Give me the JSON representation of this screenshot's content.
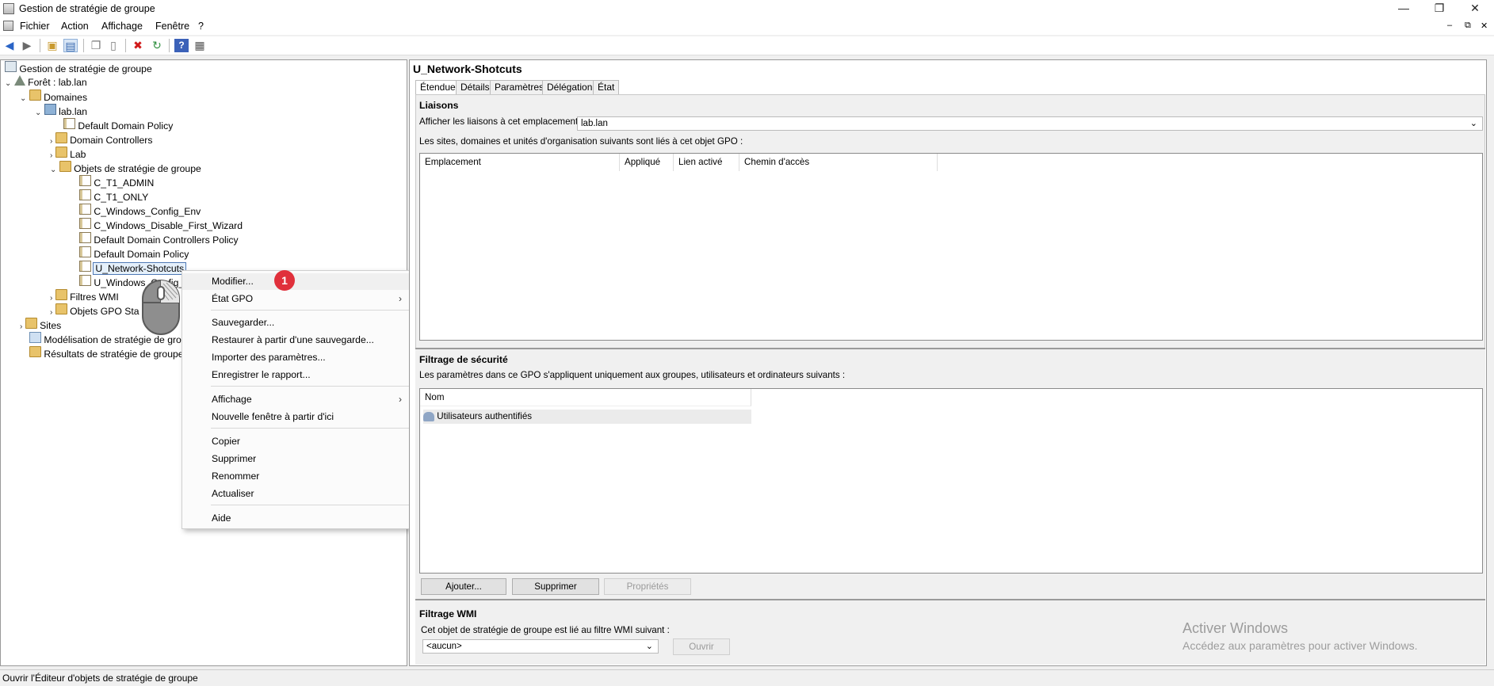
{
  "window": {
    "title": "Gestion de stratégie de groupe",
    "controls": [
      "—",
      "❐",
      "✕"
    ],
    "inner_controls": [
      "–",
      "⧉",
      "✕"
    ]
  },
  "menubar": {
    "items": [
      "Fichier",
      "Action",
      "Affichage",
      "Fenêtre",
      "?"
    ]
  },
  "tree": {
    "root": "Gestion de stratégie de groupe",
    "forest": "Forêt : lab.lan",
    "domains": "Domaines",
    "domain": "lab.lan",
    "default_domain_policy": "Default Domain Policy",
    "domain_controllers": "Domain Controllers",
    "lab": "Lab",
    "gpo_container": "Objets de stratégie de groupe",
    "gpos": [
      "C_T1_ADMIN",
      "C_T1_ONLY",
      "C_Windows_Config_Env",
      "C_Windows_Disable_First_Wizard",
      "Default Domain Controllers Policy",
      "Default Domain Policy",
      "U_Network-Shotcuts",
      "U_Windows_Config_"
    ],
    "wmi_filters": "Filtres WMI",
    "starter_gpos": "Objets GPO Sta",
    "sites": "Sites",
    "modeling": "Modélisation de stratégie de gro",
    "results": "Résultats de stratégie de groupe"
  },
  "context_menu": {
    "badge": "1",
    "items": {
      "modifier": "Modifier...",
      "etat_gpo": "État GPO",
      "sauvegarder": "Sauvegarder...",
      "restaurer": "Restaurer à partir d'une sauvegarde...",
      "importer": "Importer des paramètres...",
      "enregistrer": "Enregistrer le rapport...",
      "affichage": "Affichage",
      "nouvelle_fenetre": "Nouvelle fenêtre à partir d'ici",
      "copier": "Copier",
      "supprimer": "Supprimer",
      "renommer": "Renommer",
      "actualiser": "Actualiser",
      "aide": "Aide"
    }
  },
  "right": {
    "title": "U_Network-Shotcuts",
    "tabs": [
      "Étendue",
      "Détails",
      "Paramètres",
      "Délégation",
      "État"
    ],
    "liaisons": {
      "header": "Liaisons",
      "show_links_label": "Afficher les liaisons à cet emplacement :",
      "show_links_value": "lab.lan",
      "description": "Les sites, domaines et unités d'organisation suivants sont liés à cet objet GPO :",
      "columns": [
        "Emplacement",
        "Appliqué",
        "Lien activé",
        "Chemin d'accès"
      ]
    },
    "security": {
      "header": "Filtrage de sécurité",
      "description": "Les paramètres dans ce GPO s'appliquent uniquement aux groupes, utilisateurs et ordinateurs suivants :",
      "column": "Nom",
      "rows": [
        "Utilisateurs authentifiés"
      ],
      "buttons": {
        "add": "Ajouter...",
        "remove": "Supprimer",
        "props": "Propriétés"
      }
    },
    "wmi": {
      "header": "Filtrage WMI",
      "description": "Cet objet de stratégie de groupe est lié au filtre WMI suivant :",
      "value": "<aucun>",
      "open": "Ouvrir"
    },
    "watermark": {
      "title": "Activer Windows",
      "subtitle": "Accédez aux paramètres pour activer Windows."
    }
  },
  "status": "Ouvrir l'Éditeur d'objets de stratégie de groupe"
}
